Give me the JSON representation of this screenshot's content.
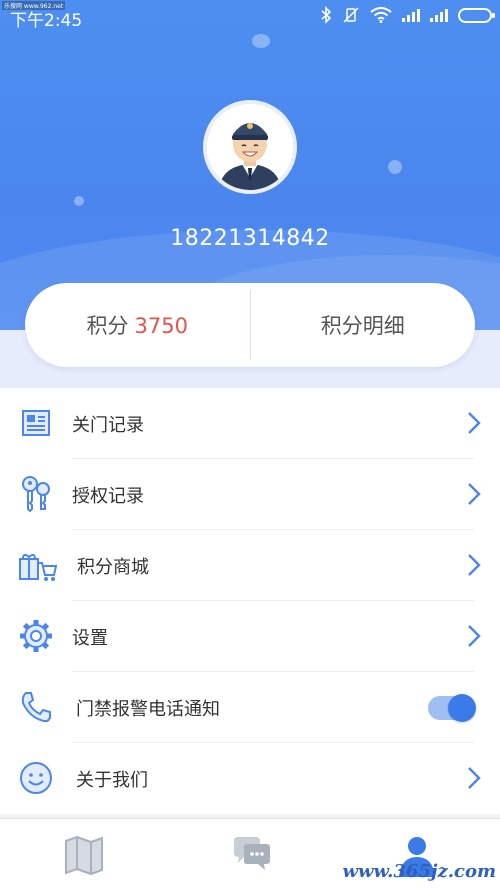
{
  "status_bar": {
    "time": "下午2:45",
    "watermark": "乐搜网 www.962.net"
  },
  "profile": {
    "phone": "18221314842"
  },
  "points": {
    "label": "积分",
    "value": "3750",
    "detail_label": "积分明细"
  },
  "menu": [
    {
      "label": "关门记录",
      "icon": "door-record-icon"
    },
    {
      "label": "授权记录",
      "icon": "keys-icon"
    },
    {
      "label": "积分商城",
      "icon": "gift-cart-icon"
    },
    {
      "label": "设置",
      "icon": "gear-icon"
    },
    {
      "label": "门禁报警电话通知",
      "icon": "phone-icon",
      "toggle_on": true
    },
    {
      "label": "关于我们",
      "icon": "smiley-icon"
    }
  ],
  "tabs": [
    {
      "icon": "map-icon",
      "active": false
    },
    {
      "icon": "chat-icon",
      "active": false
    },
    {
      "icon": "person-icon",
      "active": true
    }
  ],
  "colors": {
    "accent": "#4a86ee",
    "points_value": "#e8524a",
    "icon_blue": "#4a86ee"
  },
  "site_watermark": "www.365jz.com"
}
